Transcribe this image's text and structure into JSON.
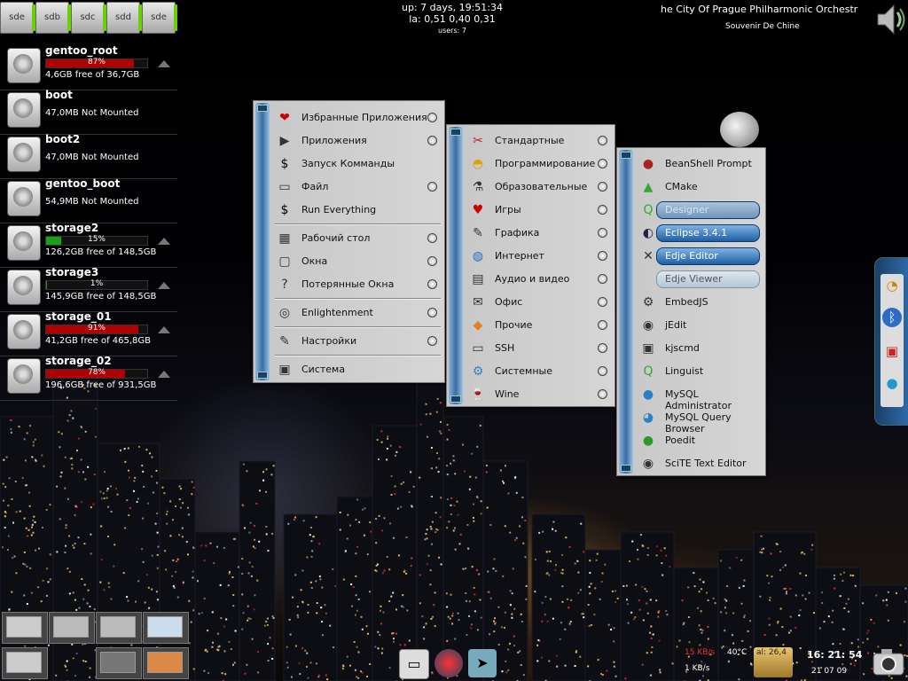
{
  "drive_buttons": [
    "sde",
    "sdb",
    "sdc",
    "sdd",
    "sde"
  ],
  "disks": [
    {
      "name": "gentoo_root",
      "percent": 87,
      "percent_label": "87%",
      "free": "4,6GB free of 36,7GB",
      "bar_color": "#b00000"
    },
    {
      "name": "boot",
      "percent": null,
      "percent_label": "",
      "free": "47,0MB Not Mounted",
      "bar_color": ""
    },
    {
      "name": "boot2",
      "percent": null,
      "percent_label": "",
      "free": "47,0MB Not Mounted",
      "bar_color": ""
    },
    {
      "name": "gentoo_boot",
      "percent": null,
      "percent_label": "",
      "free": "54,9MB Not Mounted",
      "bar_color": ""
    },
    {
      "name": "storage2",
      "percent": 15,
      "percent_label": "15%",
      "free": "126,2GB free of 148,5GB",
      "bar_color": "#18a018"
    },
    {
      "name": "storage3",
      "percent": 1,
      "percent_label": "1%",
      "free": "145,9GB free of 148,5GB",
      "bar_color": "#18a018"
    },
    {
      "name": "storage_01",
      "percent": 91,
      "percent_label": "91%",
      "free": "41,2GB free of 465,8GB",
      "bar_color": "#b00000"
    },
    {
      "name": "storage_02",
      "percent": 78,
      "percent_label": "78%",
      "free": "196,6GB free of 931,5GB",
      "bar_color": "#b00000"
    }
  ],
  "sysinfo": {
    "uptime": "up: 7 days, 19:51:34",
    "load": "la: 0,51 0,40 0,31",
    "users": "users: 7"
  },
  "music": {
    "artist": "he City Of Prague Philharmonic Orchestr",
    "track": "Souvenir De Chine"
  },
  "main_menu": [
    {
      "label": "Избранные Приложения",
      "icon": "heart-icon",
      "glyph": "❤",
      "radio": true
    },
    {
      "label": "Приложения",
      "icon": "play-icon",
      "glyph": "▶",
      "radio": true
    },
    {
      "label": "Запуск Комманды",
      "icon": "terminal-icon",
      "glyph": "$",
      "radio": false
    },
    {
      "label": "Файл",
      "icon": "folder-icon",
      "glyph": "▭",
      "radio": true
    },
    {
      "label": "Run Everything",
      "icon": "terminal-icon",
      "glyph": "$",
      "radio": false
    },
    {
      "label": "Рабочий стол",
      "icon": "desktop-grid-icon",
      "glyph": "▦",
      "radio": true
    },
    {
      "label": "Окна",
      "icon": "window-icon",
      "glyph": "▢",
      "radio": true
    },
    {
      "label": "Потерянные Окна",
      "icon": "lost-window-icon",
      "glyph": "?",
      "radio": true
    },
    {
      "label": "Enlightenment",
      "icon": "enlightenment-icon",
      "glyph": "◎",
      "radio": true
    },
    {
      "label": "Настройки",
      "icon": "wrench-icon",
      "glyph": "✎",
      "radio": true
    },
    {
      "label": "Система",
      "icon": "laptop-icon",
      "glyph": "▣",
      "radio": false
    }
  ],
  "apps_menu": [
    {
      "label": "Стандартные",
      "icon": "scissors-icon",
      "glyph": "✂"
    },
    {
      "label": "Программирование",
      "icon": "helmet-icon",
      "glyph": "◓"
    },
    {
      "label": "Образовательные",
      "icon": "flask-icon",
      "glyph": "⚗"
    },
    {
      "label": "Игры",
      "icon": "cards-icon",
      "glyph": "♥"
    },
    {
      "label": "Графика",
      "icon": "brush-icon",
      "glyph": "✎"
    },
    {
      "label": "Интернет",
      "icon": "globe-icon",
      "glyph": "◍"
    },
    {
      "label": "Аудио и видео",
      "icon": "film-icon",
      "glyph": "▤"
    },
    {
      "label": "Офис",
      "icon": "office-icon",
      "glyph": "✉"
    },
    {
      "label": "Прочие",
      "icon": "diamond-icon",
      "glyph": "◆"
    },
    {
      "label": "SSH",
      "icon": "folder-icon",
      "glyph": "▭"
    },
    {
      "label": "Системные",
      "icon": "gear-icon",
      "glyph": "⚙"
    },
    {
      "label": "Wine",
      "icon": "wine-icon",
      "glyph": "🍷"
    }
  ],
  "prog_menu": [
    {
      "label": "BeanShell Prompt",
      "icon": "bean-icon",
      "glyph": "●",
      "state": "normal"
    },
    {
      "label": "CMake",
      "icon": "cmake-icon",
      "glyph": "▲",
      "state": "normal"
    },
    {
      "label": "Designer",
      "icon": "qt-icon",
      "glyph": "Q",
      "state": "dim"
    },
    {
      "label": "Eclipse 3.4.1",
      "icon": "eclipse-icon",
      "glyph": "◐",
      "state": "highlight"
    },
    {
      "label": "Edje Editor",
      "icon": "edje-icon",
      "glyph": "✕",
      "state": "highlight"
    },
    {
      "label": "Edje Viewer",
      "icon": "edje-viewer-icon",
      "glyph": "",
      "state": "ghost"
    },
    {
      "label": "EmbedJS",
      "icon": "embedjs-icon",
      "glyph": "⚙",
      "state": "normal"
    },
    {
      "label": "jEdit",
      "icon": "jedit-icon",
      "glyph": "◉",
      "state": "normal"
    },
    {
      "label": "kjscmd",
      "icon": "kjscmd-icon",
      "glyph": "▣",
      "state": "normal"
    },
    {
      "label": "Linguist",
      "icon": "qt-icon",
      "glyph": "Q",
      "state": "normal"
    },
    {
      "label": "MySQL Administrator",
      "icon": "mysql-icon",
      "glyph": "●",
      "state": "normal"
    },
    {
      "label": "MySQL Query Browser",
      "icon": "mysql-icon",
      "glyph": "◕",
      "state": "normal"
    },
    {
      "label": "Poedit",
      "icon": "poedit-icon",
      "glyph": "●",
      "state": "normal"
    },
    {
      "label": "SciTE Text Editor",
      "icon": "scite-icon",
      "glyph": "◉",
      "state": "normal"
    }
  ],
  "tray": {
    "net_up": "15 KB/s",
    "net_down": "1 KB/s",
    "temp": "40°C",
    "battery": "al: 26,4",
    "time": "16: 21: 54",
    "date": "21 07 09"
  },
  "colors": {
    "menu_rail": "#3a6da3",
    "highlight": "#1f5fa3"
  }
}
